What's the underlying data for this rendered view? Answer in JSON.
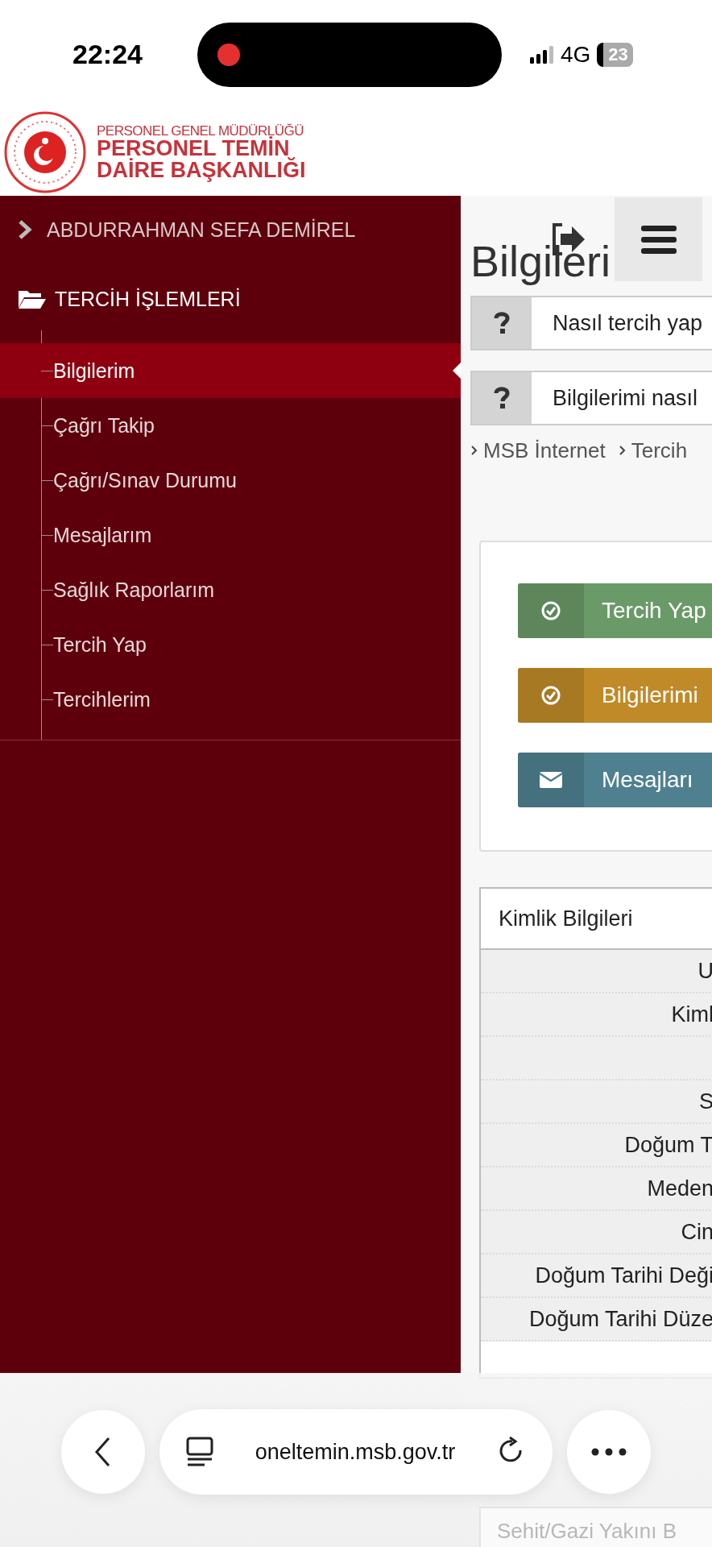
{
  "status_bar": {
    "time": "22:24",
    "network": "4G",
    "battery": "23",
    "recording": true
  },
  "header": {
    "logo_lines": [
      "PERSONEL GENEL MÜDÜRLÜĞÜ",
      "PERSONEL TEMİN",
      "DAİRE BAŞKANLIĞI"
    ]
  },
  "sidebar": {
    "user": "ABDURRAHMAN SEFA DEMİREL",
    "section": "TERCİH İŞLEMLERİ",
    "items": [
      {
        "label": "Bilgilerim",
        "selected": true
      },
      {
        "label": "Çağrı Takip",
        "selected": false
      },
      {
        "label": "Çağrı/Sınav Durumu",
        "selected": false
      },
      {
        "label": "Mesajlarım",
        "selected": false
      },
      {
        "label": "Sağlık Raporlarım",
        "selected": false
      },
      {
        "label": "Tercih Yap",
        "selected": false
      },
      {
        "label": "Tercihlerim",
        "selected": false
      }
    ]
  },
  "page": {
    "title": "Bilgileri",
    "help_links": [
      "Nasıl tercih yap",
      "Bilgilerimi nasıl"
    ],
    "breadcrumb": [
      "MSB İnternet",
      "Tercih"
    ],
    "action_buttons": [
      {
        "label": "Tercih Yap",
        "kind": "check",
        "color": "#6a9a68"
      },
      {
        "label": "Bilgilerimi",
        "kind": "check",
        "color": "#c08a28"
      },
      {
        "label": "Mesajları",
        "kind": "mail",
        "color": "#4f808f"
      }
    ],
    "identity_panel": {
      "title": "Kimlik Bilgileri",
      "rows": [
        {
          "kind": "label",
          "label": "U"
        },
        {
          "kind": "label",
          "label": "Kiml"
        },
        {
          "kind": "blank"
        },
        {
          "kind": "label",
          "label": "S"
        },
        {
          "kind": "label",
          "label": "Doğum T"
        },
        {
          "kind": "label",
          "label": "Meden"
        },
        {
          "kind": "label",
          "label": "Cin"
        },
        {
          "kind": "label",
          "label": "Doğum Tarihi Deği"
        },
        {
          "kind": "label",
          "label": "Doğum Tarihi Düze"
        }
      ]
    },
    "next_panel_title": "Sehit/Gazi Yakını B"
  },
  "browser_bar": {
    "url": "oneltemin.msb.gov.tr"
  }
}
